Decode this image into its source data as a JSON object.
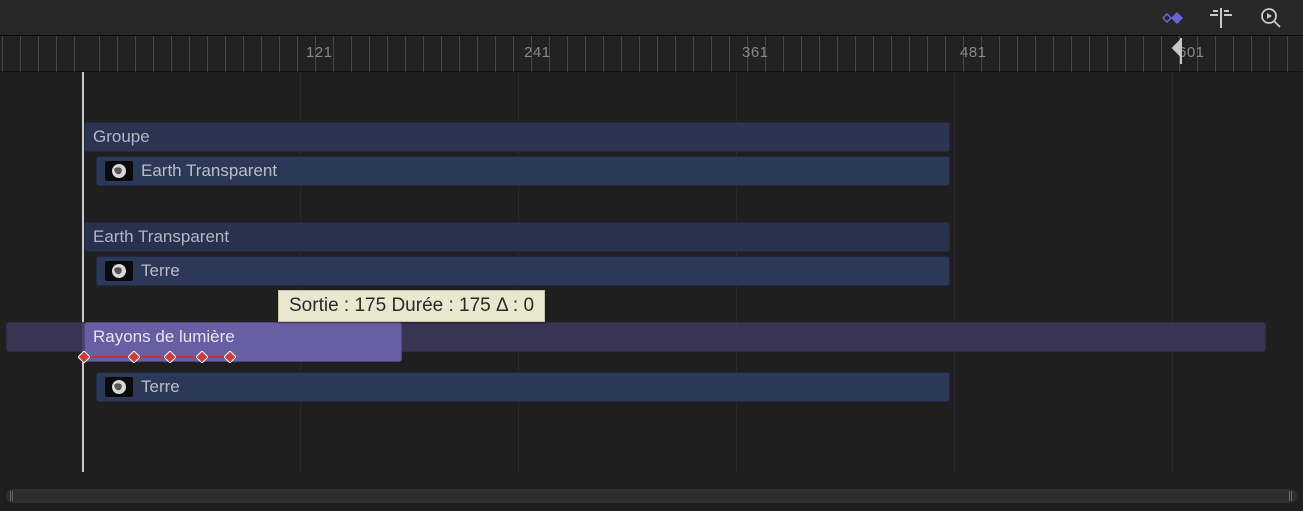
{
  "timeline": {
    "ruler_labels": [
      "121",
      "241",
      "361",
      "481",
      "601"
    ],
    "tooltip": "Sortie : 175 Durée : 175 Δ : 0",
    "group": {
      "label": "Groupe"
    },
    "clip1": {
      "label": "Earth Transparent"
    },
    "group2": {
      "label": "Earth Transparent"
    },
    "clip2": {
      "label": "Terre"
    },
    "filter": {
      "label": "Rayons de lumière"
    },
    "clip3": {
      "label": "Terre"
    }
  },
  "colors": {
    "keyframe": "#d23a3a",
    "keyframe_outline": "#ffffff",
    "tool_active": "#6b63d6",
    "tool_inactive": "#b0b0b0"
  }
}
